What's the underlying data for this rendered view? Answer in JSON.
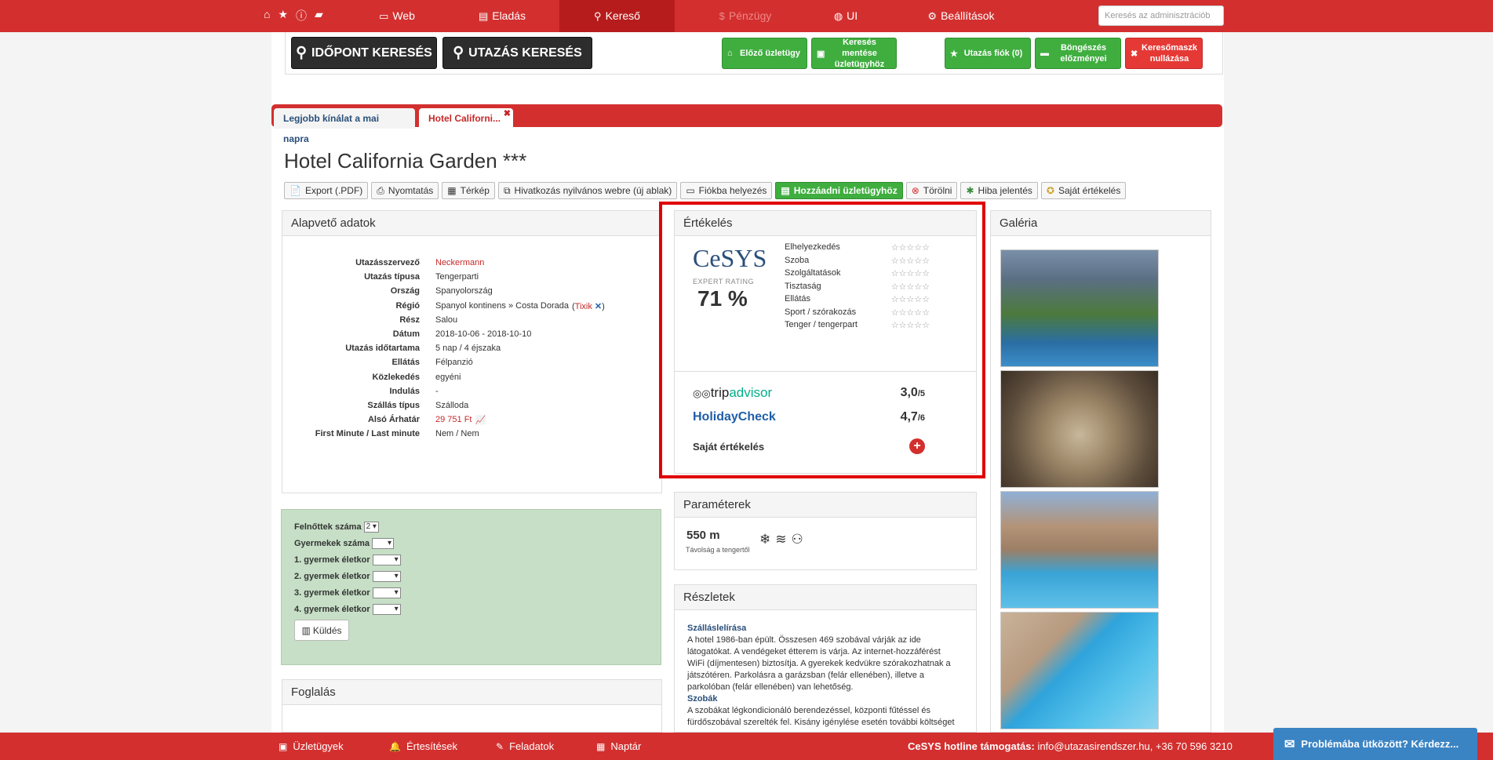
{
  "nav": {
    "items": [
      {
        "label": "Web",
        "icon": "monitor-icon"
      },
      {
        "label": "Eladás",
        "icon": "bed-icon"
      },
      {
        "label": "Kereső",
        "icon": "search-icon"
      },
      {
        "label": "Pénzügy",
        "icon": "dollar-icon"
      },
      {
        "label": "UI",
        "icon": "globe-icon"
      },
      {
        "label": "Beállítások",
        "icon": "gear-icon"
      }
    ],
    "admin_search_placeholder": "Keresés az adminisztrációb"
  },
  "search_bar": {
    "date_search": "IDŐPONT KERESÉS",
    "trip_search": "UTAZÁS KERESÉS",
    "prev_deal": "Előző üzletügy",
    "save_search": "Keresés mentése üzletügyhöz",
    "trip_account": "Utazás fiók (0)",
    "browse_history": "Böngészés előzményei",
    "reset_mask": "Keresőmaszk nullázása"
  },
  "tabs": [
    {
      "label": "Legjobb kínálat a mai napra"
    },
    {
      "label": "Hotel Californi..."
    }
  ],
  "hotel": {
    "title": "Hotel California Garden ***",
    "toolbar": [
      {
        "label": "Export (.PDF)"
      },
      {
        "label": "Nyomtatás"
      },
      {
        "label": "Térkép"
      },
      {
        "label": "Hivatkozás nyilvános webre (új ablak)"
      },
      {
        "label": "Fiókba helyezés"
      },
      {
        "label": "Hozzáadni üzletügyhöz"
      },
      {
        "label": "Törölni"
      },
      {
        "label": "Hiba jelentés"
      },
      {
        "label": "Saját értékelés"
      }
    ]
  },
  "basic": {
    "title": "Alapvető adatok",
    "rows": [
      {
        "k": "Utazásszervező",
        "v": "Neckermann"
      },
      {
        "k": "Utazás típusa",
        "v": "Tengerparti"
      },
      {
        "k": "Ország",
        "v": "Spanyolország"
      },
      {
        "k": "Régió",
        "v": "Spanyol kontinens » Costa Dorada",
        "extra": "Tixik"
      },
      {
        "k": "Rész",
        "v": "Salou"
      },
      {
        "k": "Dátum",
        "v": "2018-10-06 - 2018-10-10"
      },
      {
        "k": "Utazás időtartama",
        "v": "5 nap / 4 éjszaka"
      },
      {
        "k": "Ellátás",
        "v": "Félpanzió"
      },
      {
        "k": "Közlekedés",
        "v": "egyéni"
      },
      {
        "k": "Indulás",
        "v": "-"
      },
      {
        "k": "Szállás típus",
        "v": "Szálloda"
      },
      {
        "k": "Alsó Árhatár",
        "v": "29 751 Ft"
      },
      {
        "k": "First Minute / Last minute",
        "v": "Nem / Nem"
      }
    ]
  },
  "children_form": {
    "adults_label": "Felnőttek száma",
    "adults_value": "2",
    "children_label": "Gyermekek száma",
    "child1": "1. gyermek életkor",
    "child2": "2. gyermek életkor",
    "child3": "3. gyermek életkor",
    "child4": "4. gyermek életkor",
    "send": "Küldés"
  },
  "booking": {
    "title": "Foglalás"
  },
  "rating": {
    "title": "Értékelés",
    "logo": "CeSYS",
    "logo_sub": "EXPERT RATING",
    "percent": "71 %",
    "rated_fraction": 0.71,
    "categories": [
      {
        "label": "Elhelyezkedés",
        "stars": 0
      },
      {
        "label": "Szoba",
        "stars": 0
      },
      {
        "label": "Szolgáltatások",
        "stars": 0
      },
      {
        "label": "Tisztaság",
        "stars": 0
      },
      {
        "label": "Ellátás",
        "stars": 0
      },
      {
        "label": "Sport / szórakozás",
        "stars": 0
      },
      {
        "label": "Tenger / tengerpart",
        "stars": 0
      }
    ],
    "tripadvisor_trip": "trip",
    "tripadvisor_advisor": "advisor",
    "tripadvisor_score": "3,0",
    "tripadvisor_max": "/5",
    "holidaycheck": "HolidayCheck",
    "holidaycheck_score": "4,7",
    "holidaycheck_max": "/6",
    "own_label": "Saját értékelés"
  },
  "params": {
    "title": "Paraméterek",
    "distance": "550 m",
    "distance_label": "Távolság a tengertől"
  },
  "details": {
    "title": "Részletek",
    "h1": "Szálláslelírása",
    "p1": "A hotel 1986-ban épült. Összesen 469 szobával várják az ide látogatókat. A vendégeket étterem is várja. Az internet-hozzáférést WiFi (díjmentesen) biztosítja. A gyerekek kedvükre szórakozhatnak a játszótéren. Parkolásra a garázsban (felár ellenében), illetve a parkolóban (felár ellenében) van lehetőség.",
    "h2": "Szobák",
    "p2": "A szobákat légkondicionáló berendezéssel, központi fűtéssel és fürdőszobával szerelték fel. Kisány igénylése esetén további költséget"
  },
  "gallery": {
    "title": "Galéria"
  },
  "bottom": {
    "items": [
      {
        "label": "Üzletügyek"
      },
      {
        "label": "Értesítések"
      },
      {
        "label": "Feladatok"
      },
      {
        "label": "Naptár"
      }
    ],
    "hotline_label": "CeSYS hotline támogatás:",
    "hotline_value": "info@utazasirendszer.hu, +36 70 596 3210",
    "chat": "Problémába ütközött? Kérdezz..."
  }
}
